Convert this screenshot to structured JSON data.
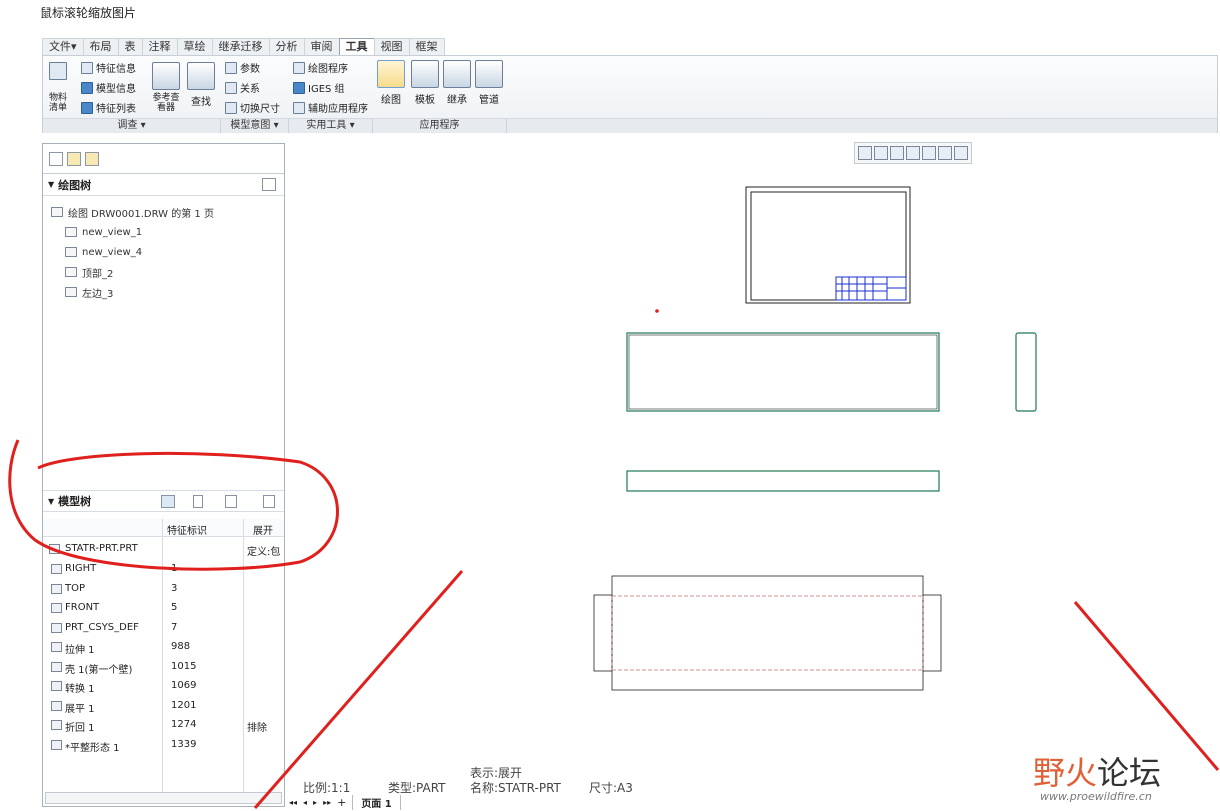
{
  "page_heading": "鼠标滚轮缩放图片",
  "ribbon": {
    "tabs": [
      "文件▾",
      "布局",
      "表",
      "注释",
      "草绘",
      "继承迁移",
      "分析",
      "审阅",
      "工具",
      "视图",
      "框架"
    ],
    "active_tab": "工具",
    "groups": {
      "investigate": "调查 ▾",
      "model_intent": "模型意图 ▾",
      "utilities": "实用工具 ▾",
      "applications": "应用程序"
    },
    "items": {
      "bom": "物料\n清单",
      "feature_info": "特征信息",
      "model_info": "模型信息",
      "feature_list": "特征列表",
      "reference_viewer": "参考查看器",
      "find": "查找",
      "parameters": "参数",
      "relations": "关系",
      "switch_dims": "切换尺寸",
      "drawing_program": "绘图程序",
      "iges_group": "IGES 组",
      "aux_apps": "辅助应用程序",
      "drawing": "绘图",
      "template": "模板",
      "inherit": "继承",
      "piping": "管道"
    }
  },
  "drawing_tree": {
    "title": "绘图树",
    "items": [
      "绘图 DRW0001.DRW 的第 1 页",
      "new_view_1",
      "new_view_4",
      "顶部_2",
      "左边_3"
    ]
  },
  "model_tree": {
    "title": "模型树",
    "columns": [
      "特征标识",
      "展开"
    ],
    "root": {
      "name": "STATR-PRT.PRT",
      "extra": "定义:包"
    },
    "rows": [
      {
        "name": "RIGHT",
        "id": "1",
        "extra": ""
      },
      {
        "name": "TOP",
        "id": "3",
        "extra": ""
      },
      {
        "name": "FRONT",
        "id": "5",
        "extra": ""
      },
      {
        "name": "PRT_CSYS_DEF",
        "id": "7",
        "extra": ""
      },
      {
        "name": "拉伸 1",
        "id": "988",
        "extra": ""
      },
      {
        "name": "壳 1(第一个壁)",
        "id": "1015",
        "extra": ""
      },
      {
        "name": "转换 1",
        "id": "1069",
        "extra": ""
      },
      {
        "name": "展平 1",
        "id": "1201",
        "extra": ""
      },
      {
        "name": "折回 1",
        "id": "1274",
        "extra": "排除"
      },
      {
        "name": "*平整形态 1",
        "id": "1339",
        "extra": ""
      }
    ]
  },
  "status": {
    "scale": "比例:1:1",
    "type": "类型:PART",
    "representation": "表示:展开",
    "name": "名称:STATR-PRT",
    "size": "尺寸:A3",
    "page_label": "页面 1"
  },
  "watermark": {
    "first": "野火",
    "second": "论坛",
    "url": "www.proewildfire.cn"
  },
  "colors": {
    "view_outline": "#1f7a55",
    "annotation_red": "#e0201c",
    "title_block_blue": "#1a2fd0"
  }
}
